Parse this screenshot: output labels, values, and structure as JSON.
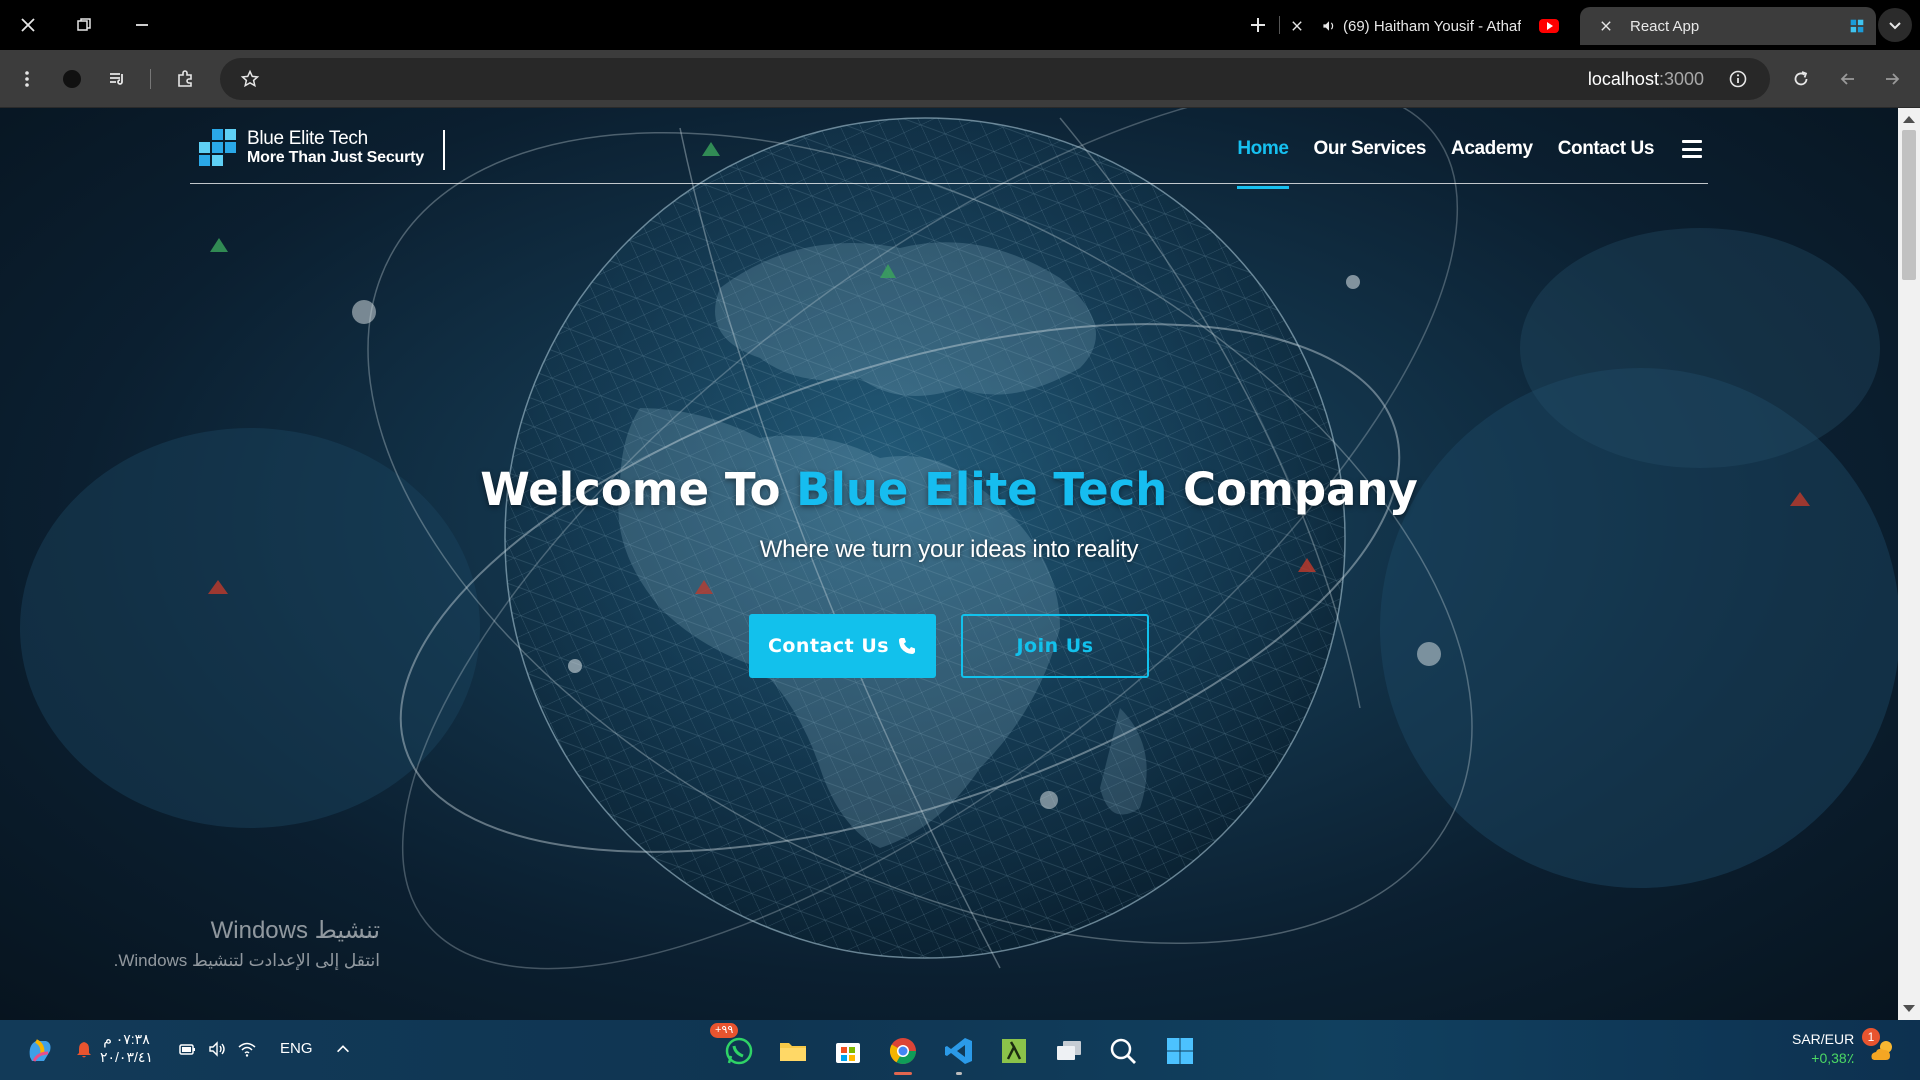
{
  "browser": {
    "tabs": [
      {
        "title": "(69) Haitham Yousif - Athaf",
        "icon": "youtube-icon"
      },
      {
        "title": "React App",
        "icon": "react-icon",
        "active": true
      }
    ],
    "url_host": "localhost",
    "url_port": ":3000"
  },
  "site": {
    "brand_name": "Blue Elite Tech",
    "brand_tagline": "More Than Just Securty",
    "nav": [
      {
        "label": "Home",
        "active": true
      },
      {
        "label": "Our Services"
      },
      {
        "label": "Academy"
      },
      {
        "label": "Contact Us"
      }
    ],
    "hero": {
      "title_pre": "Welcome To ",
      "title_accent": "Blue Elite Tech",
      "title_post": " Company",
      "subtitle": "Where we turn your ideas into reality",
      "contact_label": "Contact Us",
      "join_label": "Join Us"
    },
    "accent_color": "#16bdf0"
  },
  "os": {
    "activation_title": "تنشيط Windows",
    "activation_sub": "انتقل إلى الإعدادت لتنشيط Windows.",
    "clock_time": "٠٧:٣٨ م",
    "clock_date": "٢٠/٠٣/٤١",
    "language": "ENG",
    "whatsapp_badge": "+٩٩",
    "ticker_pair": "SAR/EUR",
    "ticker_change": "+0,38٪",
    "notification_count": "1"
  }
}
